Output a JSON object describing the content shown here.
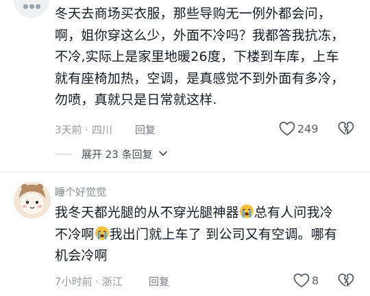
{
  "comments": [
    {
      "text": "冬天去商场买衣服，那些导购无一例外都会问，\n啊，姐你穿这么少，外面不冷吗？我都答我抗冻，\n不冷,实际上是家里地暖26度，下楼到车库，上车\n就有座椅加热，空调，是真感觉不到外面有多冷，\n勿喷，真就只是日常就这样.",
      "meta": "3天前 · 四川",
      "reply_label": "回复",
      "likes": "249",
      "expand_label": "展开 23 条回复"
    },
    {
      "username": "睡个好觉觉",
      "text_part1": "我冬天都光腿的从不穿光腿神器",
      "text_part2": "总有人问我冷",
      "text_part3": "不冷啊",
      "text_part4": "我出门就上车了 到公司又有空调。哪有",
      "text_part5": "机会冷啊",
      "meta": "7小时前 · 浙江",
      "reply_label": "回复",
      "likes": "8"
    }
  ],
  "icons": {
    "like": "heart-outline-icon",
    "dislike": "broken-heart-icon",
    "expand": "chevron-down-icon",
    "emoji": "crying-face-emoji-icon"
  },
  "colors": {
    "text": "#161823",
    "meta": "#9a9ca3",
    "icon": "#5a5c63"
  }
}
